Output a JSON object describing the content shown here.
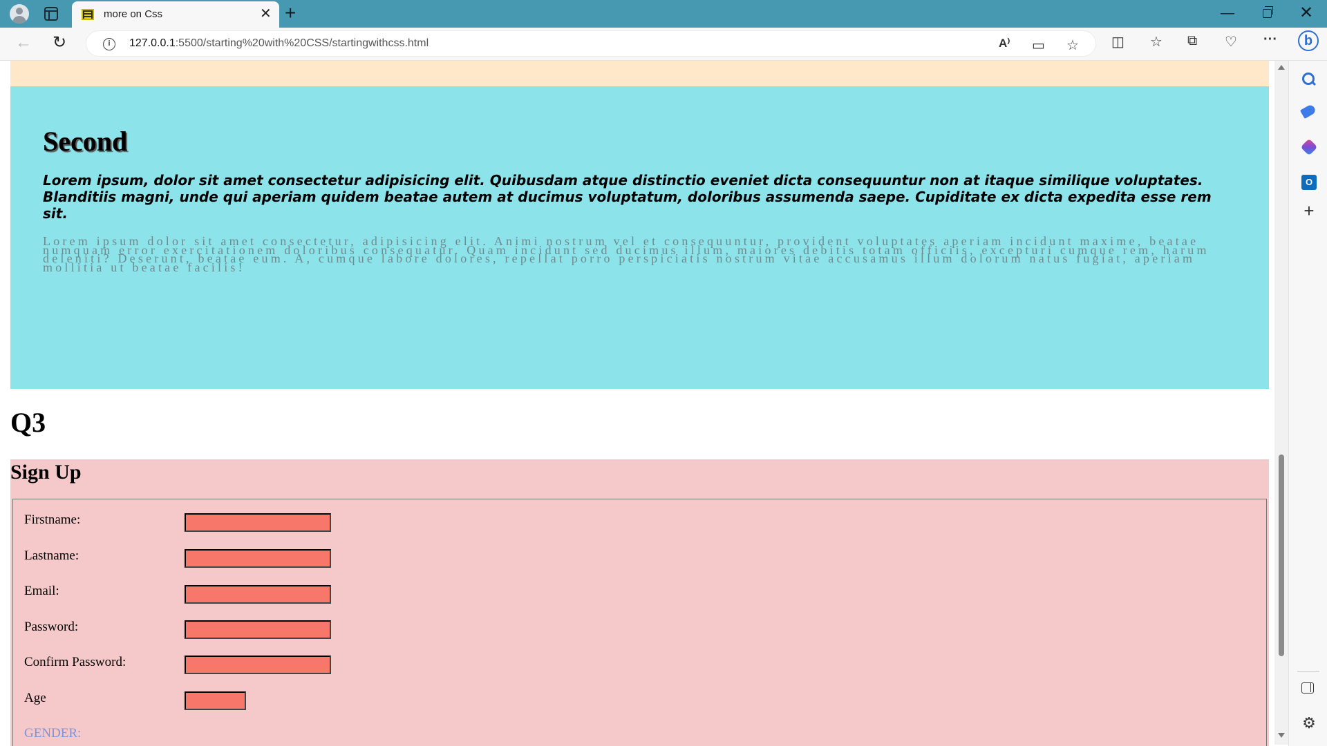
{
  "browser": {
    "tab_title": "more on Css",
    "new_tab": "+",
    "close_tab": "✕",
    "url_host": "127.0.0.1",
    "url_path": ":5500/starting%20with%20CSS/startingwithcss.html",
    "window_controls": {
      "minimize": "—",
      "close": "✕"
    }
  },
  "content": {
    "second": {
      "title": "Second",
      "bold_paragraph": "Lorem ipsum, dolor sit amet consectetur adipisicing elit. Quibusdam atque distinctio eveniet dicta consequuntur non at itaque similique voluptates. Blanditiis magni, unde qui aperiam quidem beatae autem at ducimus voluptatum, doloribus assumenda saepe. Cupiditate ex dicta expedita esse rem sit.",
      "spaced_paragraph": "Lorem ipsum dolor sit amet consectetur, adipisicing elit. Animi nostrum vel et consequuntur, provident voluptates aperiam incidunt maxime, beatae numquam error exercitationem doloribus consequatur. Quam incidunt sed ducimus illum, maiores debitis totam officiis, excepturi cumque rem, harum deleniti? Deserunt, beatae eum. A, cumque labore dolores, repellat porro perspiciatis nostrum vitae accusamus illum dolorum natus fugiat, aperiam mollitia ut beatae facilis!"
    },
    "q3_heading": "Q3",
    "signup": {
      "title": "Sign Up",
      "fields": {
        "firstname": {
          "label": "Firstname:",
          "value": ""
        },
        "lastname": {
          "label": "Lastname:",
          "value": ""
        },
        "email": {
          "label": "Email:",
          "value": ""
        },
        "password": {
          "label": "Password:",
          "value": ""
        },
        "confirm_password": {
          "label": "Confirm Password:",
          "value": ""
        },
        "age": {
          "label": "Age",
          "value": ""
        }
      },
      "gender_label": "GENDER:"
    }
  },
  "colors": {
    "titlebar": "#4699b0",
    "peach_section": "#ffe8c9",
    "cyan_section": "#8ce3ea",
    "signup_section": "#f5c9c9",
    "input_fill": "#f8776b",
    "gender_label": "#7e94d6"
  }
}
